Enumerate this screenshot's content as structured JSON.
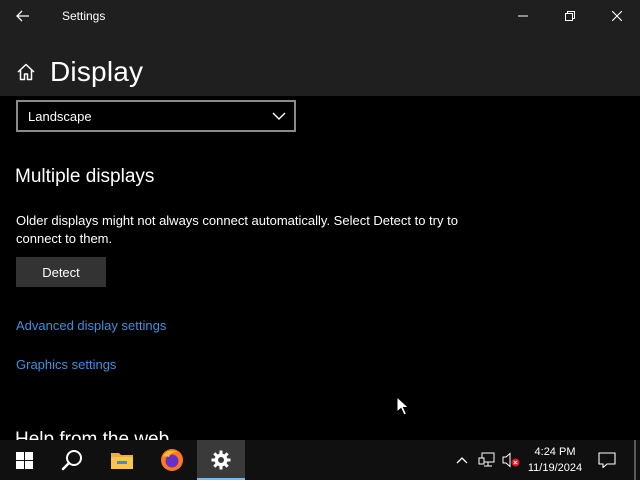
{
  "window": {
    "title": "Settings",
    "back_icon": "back-arrow-icon",
    "minimize_icon": "minimize-icon",
    "maximize_icon": "restore-icon",
    "close_icon": "close-icon"
  },
  "header": {
    "home_icon": "home-icon",
    "title": "Display"
  },
  "orientation": {
    "selected": "Landscape",
    "chevron_icon": "chevron-down-icon"
  },
  "multiple_displays": {
    "heading": "Multiple displays",
    "description": "Older displays might not always connect automatically. Select Detect to try to connect to them.",
    "detect_label": "Detect"
  },
  "links": {
    "advanced": "Advanced display settings",
    "graphics": "Graphics settings"
  },
  "cutoff_heading": "Help from the web",
  "taskbar": {
    "items": [
      "start-icon",
      "search-icon",
      "file-explorer-icon",
      "firefox-icon",
      "settings-icon"
    ],
    "active_item": "settings-icon",
    "tray": [
      "chevron-up-icon",
      "network-icon",
      "volume-muted-icon",
      "notification-icon"
    ],
    "time": "4:24 PM",
    "date": "11/19/2024"
  },
  "colors": {
    "link": "#3d8fe0",
    "background": "#000000",
    "titlebar": "#1f1f1f",
    "button": "#333333",
    "taskbar": "#101010",
    "active_indicator": "#76b9ed"
  }
}
